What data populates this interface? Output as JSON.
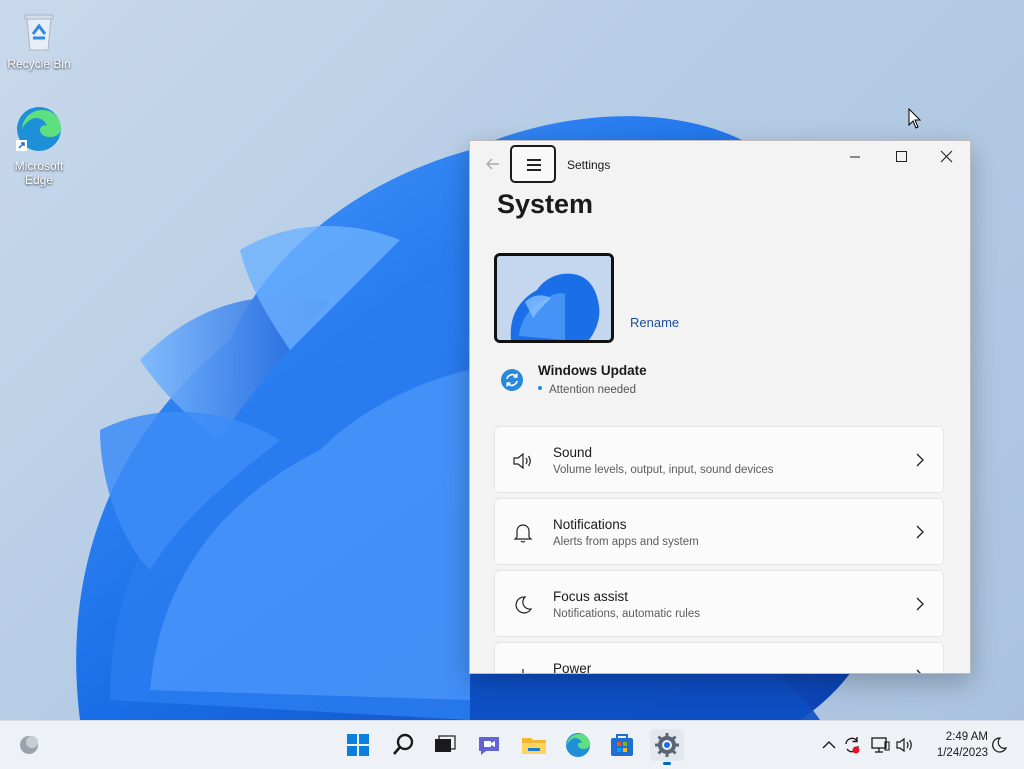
{
  "desktop": {
    "icons": [
      {
        "label": "Recycle Bin"
      },
      {
        "label": "Microsoft\nEdge"
      }
    ]
  },
  "window": {
    "app_title": "Settings",
    "page_title": "System",
    "rename_label": "Rename",
    "windows_update": {
      "title": "Windows Update",
      "status": "Attention needed"
    },
    "cards": [
      {
        "title": "Sound",
        "subtitle": "Volume levels, output, input, sound devices",
        "icon": "speaker-icon"
      },
      {
        "title": "Notifications",
        "subtitle": "Alerts from apps and system",
        "icon": "bell-icon"
      },
      {
        "title": "Focus assist",
        "subtitle": "Notifications, automatic rules",
        "icon": "moon-icon"
      },
      {
        "title": "Power",
        "subtitle": "",
        "icon": "power-icon"
      }
    ]
  },
  "taskbar": {
    "apps": [
      "start-icon",
      "search-icon",
      "task-view-icon",
      "chat-icon",
      "file-explorer-icon",
      "edge-icon",
      "store-icon",
      "settings-icon"
    ],
    "time": "2:49 AM",
    "date": "1/24/2023"
  },
  "colors": {
    "accent": "#0067c0",
    "link": "#1b4f9a",
    "wallpaper_blue": "#1a73e8"
  }
}
